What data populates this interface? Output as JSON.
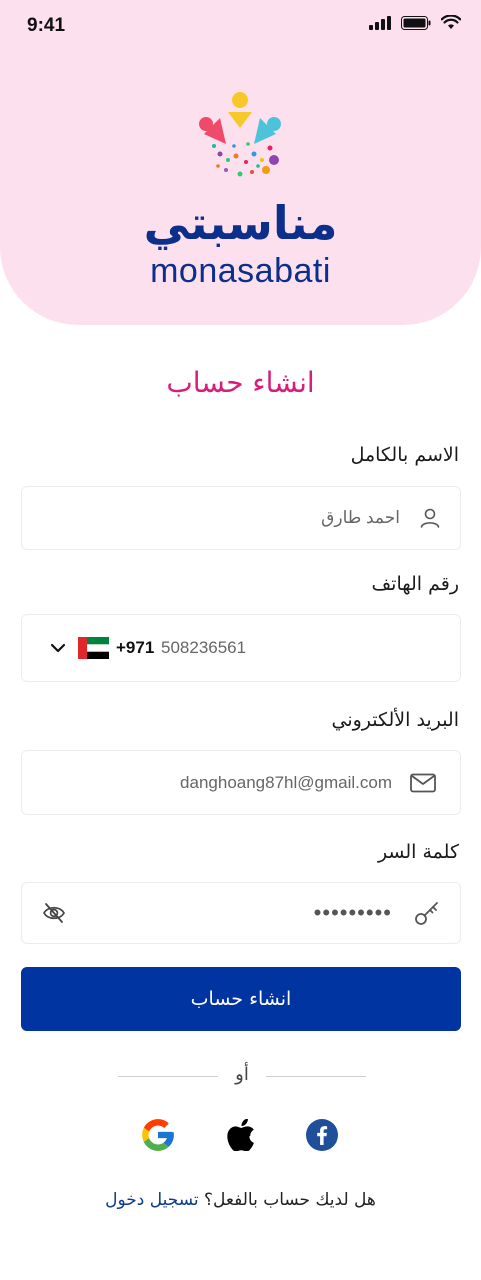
{
  "status_bar": {
    "time": "9:41"
  },
  "brand": {
    "name_ar": "مناسبتي",
    "name_en": "monasabati"
  },
  "page": {
    "title": "انشاء حساب"
  },
  "form": {
    "full_name": {
      "label": "الاسم بالكامل",
      "value": "احمد طارق",
      "icon": "user-icon"
    },
    "phone": {
      "label": "رقم الهاتف",
      "country_code": "+971",
      "number": "508236561",
      "flag": "uae-flag-icon"
    },
    "email": {
      "label": "البريد الألكتروني",
      "value": "danghoang87hl@gmail.com",
      "icon": "mail-icon"
    },
    "password": {
      "label": "كلمة السر",
      "masked_value": "•••••••••",
      "icon": "key-icon",
      "toggle_icon": "eye-off-icon"
    }
  },
  "submit": {
    "label": "انشاء حساب",
    "color": "#0034a0"
  },
  "divider": {
    "or": "أو"
  },
  "social": [
    "google-icon",
    "apple-icon",
    "facebook-icon"
  ],
  "login": {
    "question": "هل لديك حساب بالفعل؟",
    "link": "تسجيل دخول"
  },
  "colors": {
    "header_bg": "#fde0ee",
    "title": "#d81e7a",
    "brand": "#0d2f8c"
  }
}
